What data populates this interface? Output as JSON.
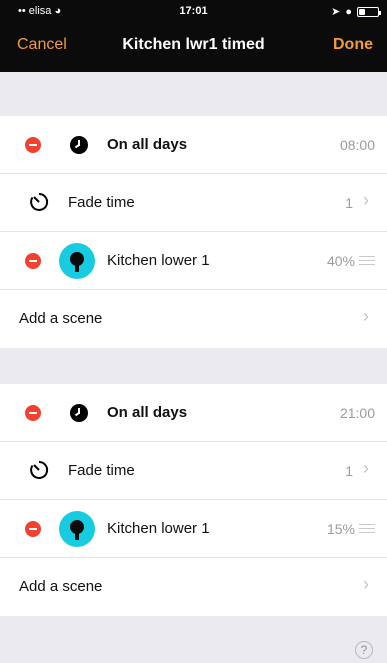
{
  "status_bar": {
    "carrier": "elisa",
    "time": "17:01",
    "battery_level": 0.35
  },
  "nav": {
    "cancel_label": "Cancel",
    "title": "Kitchen lwr1 timed",
    "done_label": "Done"
  },
  "sections": [
    {
      "trigger": {
        "label": "On all days",
        "time": "08:00"
      },
      "fade": {
        "label": "Fade time",
        "value": "1"
      },
      "scene": {
        "label": "Kitchen lower 1",
        "level": "40%"
      },
      "add_scene_label": "Add a scene"
    },
    {
      "trigger": {
        "label": "On all days",
        "time": "21:00"
      },
      "fade": {
        "label": "Fade time",
        "value": "1"
      },
      "scene": {
        "label": "Kitchen lower 1",
        "level": "15%"
      },
      "add_scene_label": "Add a scene"
    }
  ],
  "footer": {
    "help_label": "?"
  },
  "colors": {
    "accent": "#f39a3b",
    "delete": "#f2412f",
    "bulb": "#17cbe1",
    "nav_bg": "#0b0b0b"
  },
  "icons": [
    "wifi-icon",
    "location-icon",
    "alarm-icon",
    "battery-icon",
    "delete-icon",
    "clock-icon",
    "timer-icon",
    "bulb-icon",
    "chevron-right-icon",
    "reorder-handle-icon",
    "help-icon"
  ]
}
